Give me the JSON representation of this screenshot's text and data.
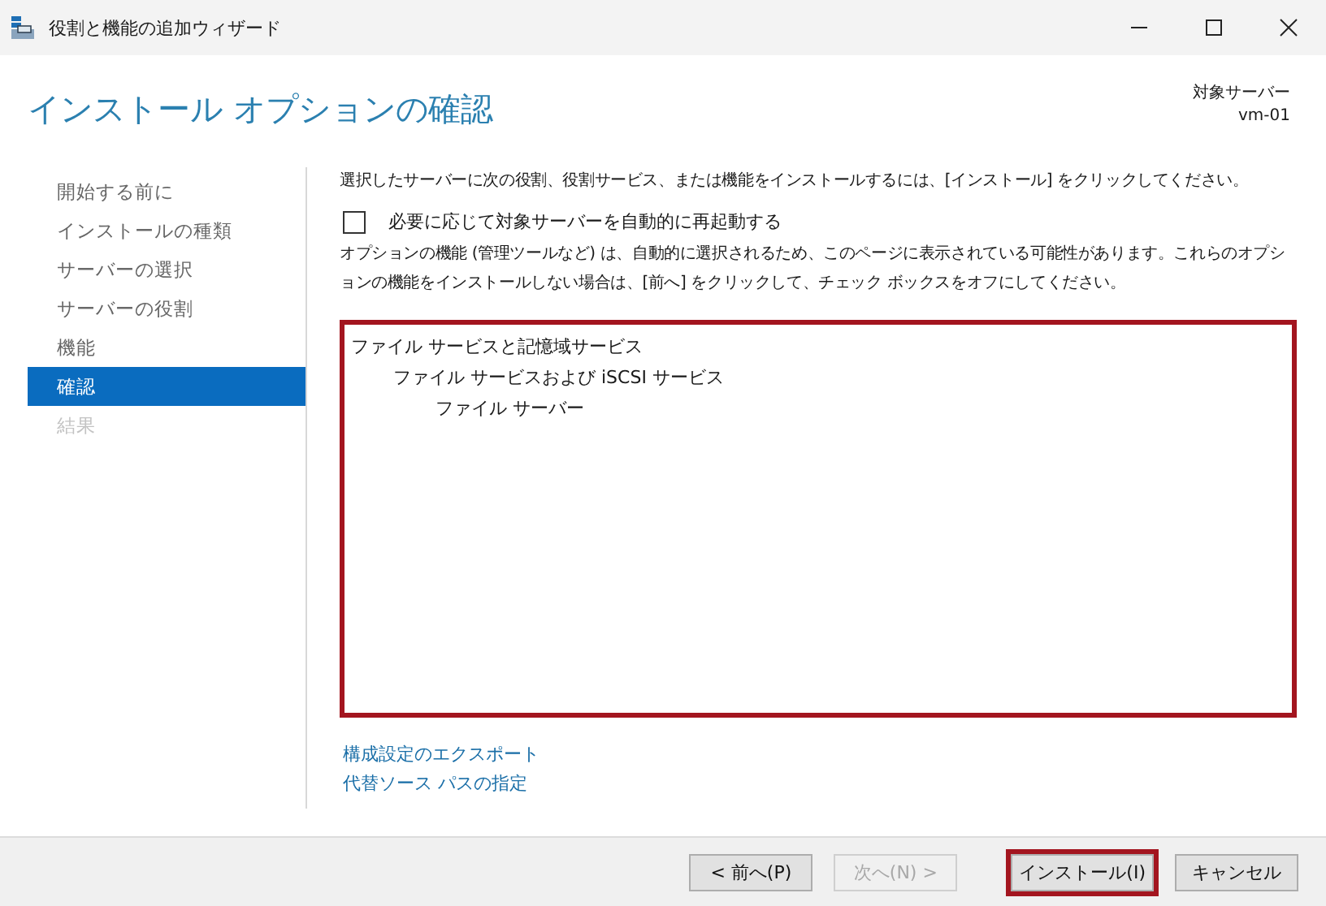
{
  "window": {
    "title": "役割と機能の追加ウィザード"
  },
  "header": {
    "title": "インストール オプションの確認",
    "target_label": "対象サーバー",
    "target_name": "vm-01"
  },
  "sidebar": {
    "items": [
      {
        "label": "開始する前に",
        "selected": false,
        "disabled": false
      },
      {
        "label": "インストールの種類",
        "selected": false,
        "disabled": false
      },
      {
        "label": "サーバーの選択",
        "selected": false,
        "disabled": false
      },
      {
        "label": "サーバーの役割",
        "selected": false,
        "disabled": false
      },
      {
        "label": "機能",
        "selected": false,
        "disabled": false
      },
      {
        "label": "確認",
        "selected": true,
        "disabled": false
      },
      {
        "label": "結果",
        "selected": false,
        "disabled": true
      }
    ]
  },
  "content": {
    "intro": "選択したサーバーに次の役割、役割サービス、または機能をインストールするには、[インストール] をクリックしてください。",
    "restart_checkbox": {
      "label": "必要に応じて対象サーバーを自動的に再起動する",
      "checked": false
    },
    "note": "オプションの機能 (管理ツールなど) は、自動的に選択されるため、このページに表示されている可能性があります。これらのオプションの機能をインストールしない場合は、[前へ] をクリックして、チェック ボックスをオフにしてください。",
    "selection": {
      "highlighted": true,
      "items": [
        {
          "label": "ファイル サービスと記憶域サービス",
          "children": [
            {
              "label": "ファイル サービスおよび iSCSI サービス",
              "children": [
                {
                  "label": "ファイル サーバー"
                }
              ]
            }
          ]
        }
      ]
    },
    "links": [
      "構成設定のエクスポート",
      "代替ソース パスの指定"
    ]
  },
  "buttons": [
    {
      "label": "< 前へ(P)",
      "disabled": false,
      "highlighted": false
    },
    {
      "label": "次へ(N) >",
      "disabled": true,
      "highlighted": false
    },
    {
      "label": "インストール(I)",
      "disabled": false,
      "highlighted": true
    },
    {
      "label": "キャンセル",
      "disabled": false,
      "highlighted": false
    }
  ]
}
